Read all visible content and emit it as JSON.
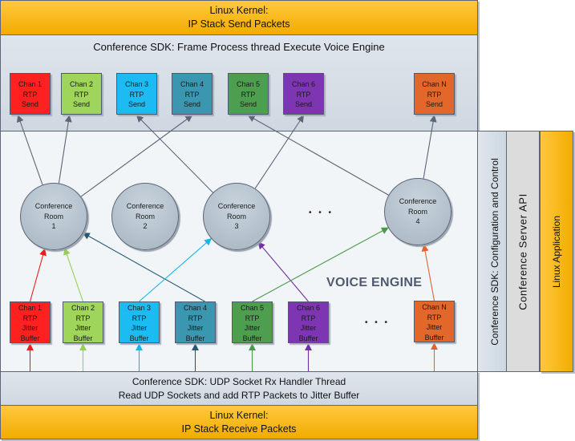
{
  "top_kernel": {
    "line1": "Linux Kernel:",
    "line2": "IP Stack Send Packets"
  },
  "frame_process": {
    "title": "Conference SDK: Frame Process thread Execute Voice Engine"
  },
  "voice_engine": {
    "label": "VOICE ENGINE",
    "ellipsis": "• • •"
  },
  "send_channels": [
    {
      "name": "Chan 1",
      "l2": "RTP",
      "l3": "Send",
      "color": "#ff2020"
    },
    {
      "name": "Chan 2",
      "l2": "RTP",
      "l3": "Send",
      "color": "#9fd55a"
    },
    {
      "name": "Chan 3",
      "l2": "RTP",
      "l3": "Send",
      "color": "#1cbcf2"
    },
    {
      "name": "Chan 4",
      "l2": "RTP",
      "l3": "Send",
      "color": "#3b97b0"
    },
    {
      "name": "Chan 5",
      "l2": "RTP",
      "l3": "Send",
      "color": "#4e9e4f"
    },
    {
      "name": "Chan 6",
      "l2": "RTP",
      "l3": "Send",
      "color": "#7d35b2"
    },
    {
      "name": "Chan N",
      "l2": "RTP",
      "l3": "Send",
      "color": "#e2672a"
    }
  ],
  "jitter_channels": [
    {
      "name": "Chan 1",
      "l2": "RTP",
      "l3": "Jitter",
      "l4": "Buffer",
      "color": "#ff2020",
      "line": "#ee1c1c"
    },
    {
      "name": "Chan 2",
      "l2": "RTP",
      "l3": "Jitter",
      "l4": "Buffer",
      "color": "#9fd55a",
      "line": "#95cf58"
    },
    {
      "name": "Chan 3",
      "l2": "RTP",
      "l3": "Jitter",
      "l4": "Buffer",
      "color": "#1cbcf2",
      "line": "#1ab4ec"
    },
    {
      "name": "Chan 4",
      "l2": "RTP",
      "l3": "Jitter",
      "l4": "Buffer",
      "color": "#3b97b0",
      "line": "#255a72"
    },
    {
      "name": "Chan 5",
      "l2": "RTP",
      "l3": "Jitter",
      "l4": "Buffer",
      "color": "#4e9e4f",
      "line": "#4b9a4c"
    },
    {
      "name": "Chan 6",
      "l2": "RTP",
      "l3": "Jitter",
      "l4": "Buffer",
      "color": "#7d35b2",
      "line": "#7030a8"
    },
    {
      "name": "Chan N",
      "l2": "RTP",
      "l3": "Jitter",
      "l4": "Buffer",
      "color": "#e2672a",
      "line": "#e0652a"
    }
  ],
  "rooms": [
    {
      "l1": "Conference",
      "l2": "Room",
      "l3": "1"
    },
    {
      "l1": "Conference",
      "l2": "Room",
      "l3": "2"
    },
    {
      "l1": "Conference",
      "l2": "Room",
      "l3": "3"
    },
    {
      "l1": "Conference",
      "l2": "Room",
      "l3": "4"
    }
  ],
  "room_to_send": [
    {
      "room": 1,
      "send": 1
    },
    {
      "room": 1,
      "send": 2
    },
    {
      "room": 1,
      "send": 4
    },
    {
      "room": 3,
      "send": 3
    },
    {
      "room": 3,
      "send": 6
    },
    {
      "room": 4,
      "send": 5
    },
    {
      "room": 4,
      "send": 7
    }
  ],
  "jitter_to_room": [
    {
      "jitter": 1,
      "room": 1
    },
    {
      "jitter": 2,
      "room": 1
    },
    {
      "jitter": 4,
      "room": 1
    },
    {
      "jitter": 3,
      "room": 3
    },
    {
      "jitter": 6,
      "room": 3
    },
    {
      "jitter": 5,
      "room": 4
    },
    {
      "jitter": 7,
      "room": 4
    }
  ],
  "udp_handler": {
    "line1": "Conference SDK: UDP Socket Rx Handler Thread",
    "line2": "Read UDP Sockets and add RTP Packets to Jitter Buffer"
  },
  "bottom_kernel": {
    "line1": "Linux Kernel:",
    "line2": "IP Stack Receive Packets"
  },
  "side_columns": {
    "config": "Conference SDK: Configuration and Control",
    "server_api": "Conference Server API",
    "linux_app": "Linux Application"
  },
  "colors": {
    "kernel": "#f5b400",
    "sdk": "#d5dde5",
    "engine": "#f2f5f8",
    "wire": "#5c6678"
  }
}
